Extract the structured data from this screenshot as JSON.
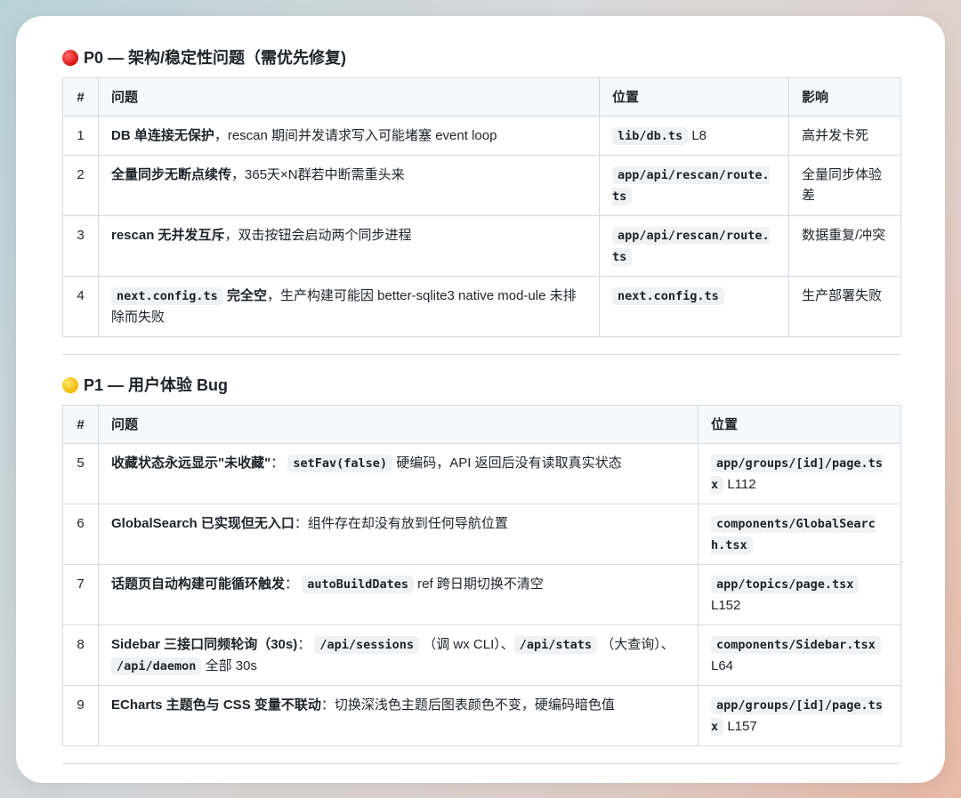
{
  "p0": {
    "title": "P0 — 架构/稳定性问题（需优先修复)",
    "headers": {
      "num": "#",
      "issue": "问题",
      "location": "位置",
      "impact": "影响"
    },
    "rows": [
      {
        "num": "1",
        "issue_bold": "DB 单连接无保护",
        "issue_rest": "，rescan 期间并发请求写入可能堵塞 event loop",
        "loc_code": "lib/db.ts",
        "loc_line": "L8",
        "impact": "高并发卡死"
      },
      {
        "num": "2",
        "issue_bold": "全量同步无断点续传",
        "issue_rest": "，365天×N群若中断需重头来",
        "loc_code": "app/api/rescan/route.ts",
        "loc_line": "",
        "impact": "全量同步体验差"
      },
      {
        "num": "3",
        "issue_bold": "rescan 无并发互斥",
        "issue_rest": "，双击按钮会启动两个同步进程",
        "loc_code": "app/api/rescan/route.ts",
        "loc_line": "",
        "impact": "数据重复/冲突"
      },
      {
        "num": "4",
        "issue_code": "next.config.ts",
        "issue_bold": "完全空",
        "issue_rest": "，生产构建可能因 better-sqlite3 native mod-ule 未排除而失败",
        "loc_code": "next.config.ts",
        "loc_line": "",
        "impact": "生产部署失败"
      }
    ]
  },
  "p1": {
    "title": "P1 — 用户体验 Bug",
    "headers": {
      "num": "#",
      "issue": "问题",
      "location": "位置"
    },
    "rows": [
      {
        "num": "5",
        "parts": [
          {
            "t": "b",
            "v": "收藏状态永远显示\"未收藏\""
          },
          {
            "t": "s",
            "v": "： "
          },
          {
            "t": "c",
            "v": "setFav(false)"
          },
          {
            "t": "s",
            "v": " 硬编码，API 返回后没有读取真实状态"
          }
        ],
        "loc_code": "app/groups/[id]/page.tsx",
        "loc_line": "L112"
      },
      {
        "num": "6",
        "parts": [
          {
            "t": "b",
            "v": "GlobalSearch 已实现但无入口"
          },
          {
            "t": "s",
            "v": "：组件存在却没有放到任何导航位置"
          }
        ],
        "loc_code": "components/GlobalSearch.tsx",
        "loc_line": ""
      },
      {
        "num": "7",
        "parts": [
          {
            "t": "b",
            "v": "话题页自动构建可能循环触发"
          },
          {
            "t": "s",
            "v": "： "
          },
          {
            "t": "c",
            "v": "autoBuildDates"
          },
          {
            "t": "s",
            "v": " ref 跨日期切换不清空"
          }
        ],
        "loc_code": "app/topics/page.tsx",
        "loc_line": "L152"
      },
      {
        "num": "8",
        "parts": [
          {
            "t": "b",
            "v": "Sidebar 三接口同频轮询（30s)"
          },
          {
            "t": "s",
            "v": "： "
          },
          {
            "t": "c",
            "v": "/api/sessions"
          },
          {
            "t": "s",
            "v": " （调 wx CLI）、"
          },
          {
            "t": "c",
            "v": "/api/stats"
          },
          {
            "t": "s",
            "v": " （大查询）、 "
          },
          {
            "t": "c",
            "v": "/api/daemon"
          },
          {
            "t": "s",
            "v": " 全部 30s"
          }
        ],
        "loc_code": "components/Sidebar.tsx",
        "loc_line": "L64"
      },
      {
        "num": "9",
        "parts": [
          {
            "t": "b",
            "v": "ECharts 主题色与 CSS 变量不联动"
          },
          {
            "t": "s",
            "v": "：切换深浅色主题后图表颜色不变，硬编码暗色值"
          }
        ],
        "loc_code": "app/groups/[id]/page.tsx",
        "loc_line": "L157"
      }
    ]
  }
}
